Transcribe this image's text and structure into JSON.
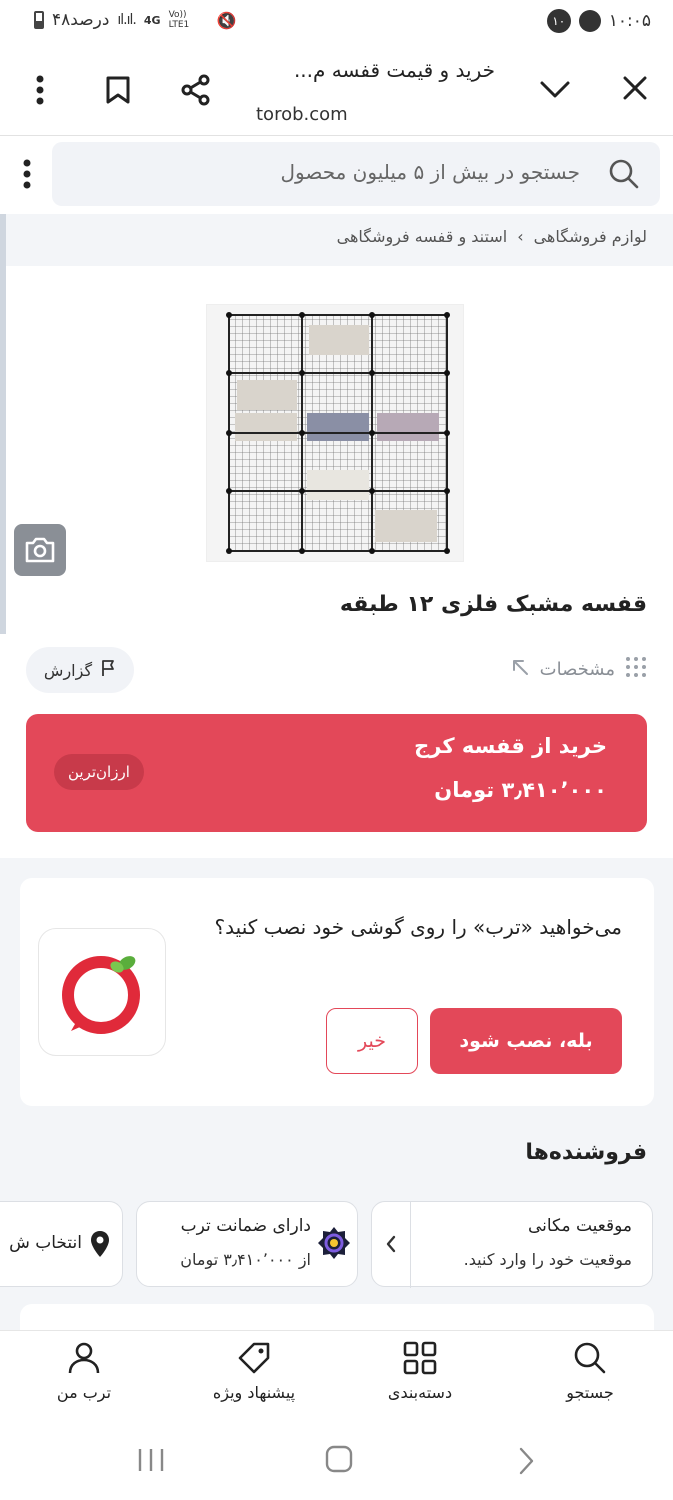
{
  "status_bar": {
    "time": "۱۰:۰۵",
    "notification_count": "۱۰",
    "battery": "۴۸درصد",
    "network": "4G",
    "volte": "Vo)) LTE1"
  },
  "browser": {
    "title": "خرید و قیمت قفسه م...",
    "url": "torob.com"
  },
  "search": {
    "placeholder": "جستجو در بیش از ۵ میلیون محصول"
  },
  "breadcrumb": {
    "items": [
      "لوازم فروشگاهی",
      "›",
      "استند و قفسه فروشگاهی"
    ]
  },
  "product": {
    "title": "قفسه مشبک فلزی ۱۲ طبقه",
    "specs_label": "مشخصات",
    "report_label": "گزارش"
  },
  "buy": {
    "line1": "خرید از قفسه کرج",
    "line2": "۳٫۴۱۰٬۰۰۰ تومان",
    "badge": "ارزان‌ترین"
  },
  "install": {
    "text": "می‌خواهید «ترب» را روی گوشی خود نصب کنید؟",
    "yes": "بله، نصب شود",
    "no": "خیر"
  },
  "sellers": {
    "title": "فروشنده‌ها",
    "location_title": "موقعیت مکانی",
    "location_sub": "موقعیت خود را وارد کنید.",
    "guarantee_title": "دارای ضمانت ترب",
    "guarantee_sub": "از ۳٫۴۱۰٬۰۰۰ تومان",
    "pick_label": "انتخاب ش"
  },
  "bottom_nav": {
    "search": "جستجو",
    "categories": "دسته‌بندی",
    "offers": "پیشنهاد ویژه",
    "profile": "ترب من"
  },
  "colors": {
    "accent": "#e34859",
    "surface": "#f3f5f8"
  }
}
